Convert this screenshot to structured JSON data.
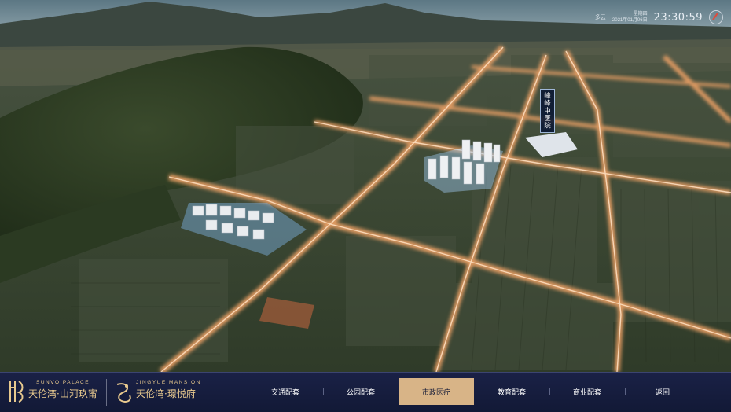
{
  "header": {
    "weather": "多云",
    "weekday": "星期四",
    "date": "2021年01月06日",
    "time": "23:30:59",
    "compass_icon": "compass-icon"
  },
  "poi": {
    "label": "峰峰中医院"
  },
  "logos": {
    "left": {
      "en": "SUNVO PALACE",
      "cn": "天伦湾·山河玖甯"
    },
    "right": {
      "en": "JINGYUE MANSION",
      "cn": "天伦湾·璟悦府"
    }
  },
  "nav": {
    "items": [
      {
        "label": "交通配套"
      },
      {
        "label": "公园配套"
      },
      {
        "label": "市政医疗"
      },
      {
        "label": "教育配套"
      },
      {
        "label": "商业配套"
      },
      {
        "label": "返回"
      }
    ],
    "active_index": 2
  },
  "colors": {
    "accent": "#d8b487",
    "bar": "#1a2146",
    "road_glow": "#f2b27a"
  }
}
